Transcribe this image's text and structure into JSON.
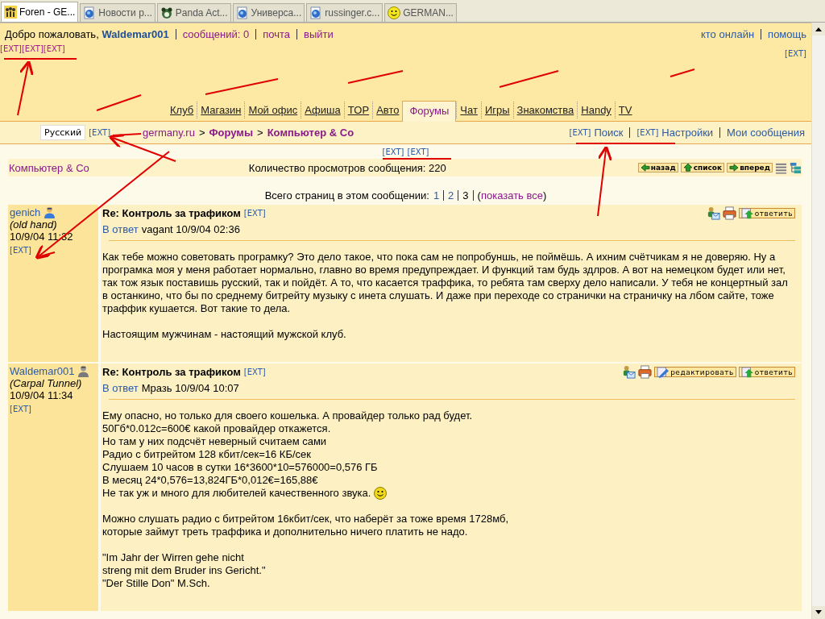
{
  "browser_tabs": [
    {
      "title": "Foren - GE...",
      "selected": true
    },
    {
      "title": "Новости р...",
      "selected": false
    },
    {
      "title": "Panda Act...",
      "selected": false
    },
    {
      "title": "Универса...",
      "selected": false
    },
    {
      "title": "russinger.c...",
      "selected": false
    },
    {
      "title": "GERMAN...",
      "selected": false
    }
  ],
  "header": {
    "welcome": "Добро пожаловать,",
    "username": "Waldemar001",
    "links": [
      "сообщений: 0",
      "почта",
      "выйти"
    ],
    "right_links": [
      "кто онлайн",
      "помощь"
    ],
    "ext_links": [
      "[EXT]",
      "[EXT]",
      "[EXT]"
    ],
    "ext_right": "[EXT]"
  },
  "nav_tabs": [
    {
      "label": "Клуб",
      "selected": false
    },
    {
      "label": "Магазин",
      "selected": false
    },
    {
      "label": "Мой офис",
      "selected": false
    },
    {
      "label": "Афиша",
      "selected": false
    },
    {
      "label": "TOP",
      "selected": false
    },
    {
      "label": "Авто",
      "selected": false
    },
    {
      "label": "Форумы",
      "selected": true
    },
    {
      "label": "Чат",
      "selected": false
    },
    {
      "label": "Игры",
      "selected": false
    },
    {
      "label": "Знакомства",
      "selected": false
    },
    {
      "label": "Handy",
      "selected": false
    },
    {
      "label": "TV",
      "selected": false
    }
  ],
  "language_button": "Русский",
  "language_ext": "[EXT]",
  "breadcrumb": [
    {
      "kind": "link",
      "label": "germany.ru"
    },
    {
      "kind": "separator",
      "label": ">"
    },
    {
      "kind": "bold-link",
      "label": "Форумы"
    },
    {
      "kind": "separator",
      "label": ">"
    },
    {
      "kind": "bold-link",
      "label": "Компьютер & Co"
    }
  ],
  "toolbar_links": [
    {
      "ext": "[EXT]",
      "label": "Поиск"
    },
    {
      "ext": "[EXT]",
      "label": "Настройки"
    },
    {
      "label": "Мои сообщения"
    }
  ],
  "center_ext": [
    "[EXT]",
    "[EXT]"
  ],
  "forum_name": "Компьютер & Co",
  "views": "Количество просмотров сообщения: 220",
  "nav_buttons": [
    {
      "kind": "back",
      "label": "назад"
    },
    {
      "kind": "up",
      "label": "список"
    },
    {
      "kind": "forward",
      "label": "вперед"
    }
  ],
  "pages": {
    "label": "Всего страниц в этом сообщении:",
    "items": [
      {
        "label": "1",
        "selected": false
      },
      {
        "label": "2",
        "selected": false
      },
      {
        "label": "3",
        "selected": true
      }
    ],
    "open": "(",
    "show_all": "показать все",
    "close": ")"
  },
  "posts": [
    {
      "author": "genich",
      "online": true,
      "rank": "(old hand)",
      "date": "10/9/04 11:32",
      "ext": "[EXT]",
      "subject": "Re: Контроль за трафиком",
      "subject_ext": "[EXT]",
      "reply_label": "В ответ",
      "reply_to": "vagant 10/9/04 02:36",
      "actions": [
        {
          "kind": "message"
        },
        {
          "kind": "print"
        },
        {
          "kind": "reply",
          "label": "ответить"
        }
      ],
      "paragraphs": [
        {
          "lines": [
            "Как тебе можно советовать програмку? Это дело такое, что пока сам не попробуншь, не поймёшь. А ихним счётчикам я не доверяю. Ну а програмка моя у меня работает нормально, главно во время предупреждает. И функций там будь здлров. А вот на немецком будет или нет, так тож язык поставишь русский, так и пойдёт. А то, что касается траффика, то ребята там сверху дело написали. У тебя не концертный зал в останкино, что бы по среднему битрейту музыку с инета слушать. И даже при переходе со странички на страничку на лбом сайте, тоже траффик кушается. Вот такие то дела."
          ],
          "smiley": false
        },
        {
          "lines": [
            "Настоящим мужчинам - настоящий мужской клуб."
          ],
          "smiley": false
        }
      ]
    },
    {
      "author": "Waldemar001",
      "online": false,
      "rank": "(Carpal Tunnel)",
      "date": "10/9/04 11:34",
      "ext": "[EXT]",
      "subject": "Re: Контроль за трафиком",
      "subject_ext": "[EXT]",
      "reply_label": "В ответ",
      "reply_to": "Мразь 10/9/04 10:07",
      "actions": [
        {
          "kind": "message"
        },
        {
          "kind": "print"
        },
        {
          "kind": "edit",
          "label": "редактировать"
        },
        {
          "kind": "reply",
          "label": "ответить"
        }
      ],
      "paragraphs": [
        {
          "lines": [
            "Ему опасно, но только для своего кошелька. А провайдер только рад будет.",
            "50Гб*0.012с=600€ какой провайдер откажется.",
            "Но там у них подсчёт неверный считаем сами",
            "Радио с битрейтом 128 кбит/сек=16 КБ/сек",
            "Слушаем 10 часов в сутки 16*3600*10=576000=0,576 ГБ",
            "В месяц 24*0,576=13,824ГБ*0,012€=165,88€",
            "Не так уж и много для любителей качественного звука."
          ],
          "smiley": true
        },
        {
          "lines": [
            "Можно слушать радио с битрейтом 16кбит/сек, что наберёт за тоже время 1728мб,",
            "которые займут треть траффика и дополнительно ничего платить не надо."
          ],
          "smiley": false
        },
        {
          "lines": [
            "\"Im Jahr der Wirren gehe nicht",
            "streng mit dem Bruder ins Gericht.\"",
            "\"Der Stille Don\" M.Sch."
          ],
          "smiley": false
        }
      ]
    }
  ]
}
